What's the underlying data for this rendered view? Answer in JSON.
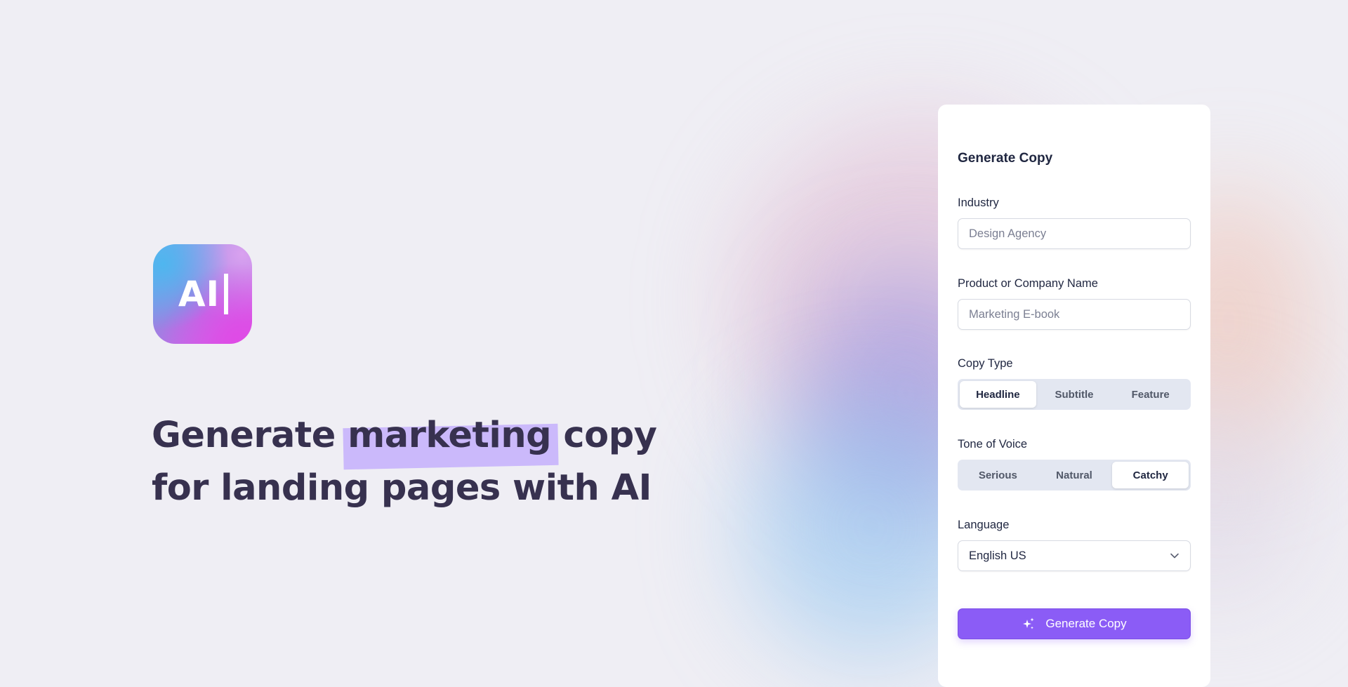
{
  "logo": {
    "text": "AI"
  },
  "hero": {
    "line1_before": "Generate ",
    "line1_highlight": "marketing",
    "line1_after": " copy",
    "line2": "for landing pages with AI"
  },
  "form": {
    "title": "Generate Copy",
    "industry": {
      "label": "Industry",
      "placeholder": "Design Agency",
      "value": ""
    },
    "product": {
      "label": "Product or Company Name",
      "placeholder": "Marketing E-book",
      "value": ""
    },
    "copy_type": {
      "label": "Copy Type",
      "options": [
        "Headline",
        "Subtitle",
        "Feature"
      ],
      "selected": "Headline"
    },
    "tone": {
      "label": "Tone of Voice",
      "options": [
        "Serious",
        "Natural",
        "Catchy"
      ],
      "selected": "Catchy"
    },
    "language": {
      "label": "Language",
      "value": "English US"
    },
    "submit_label": "Generate Copy"
  },
  "colors": {
    "accent": "#8b5cf6",
    "highlight": "#cbb9fb",
    "heading": "#37314f"
  }
}
